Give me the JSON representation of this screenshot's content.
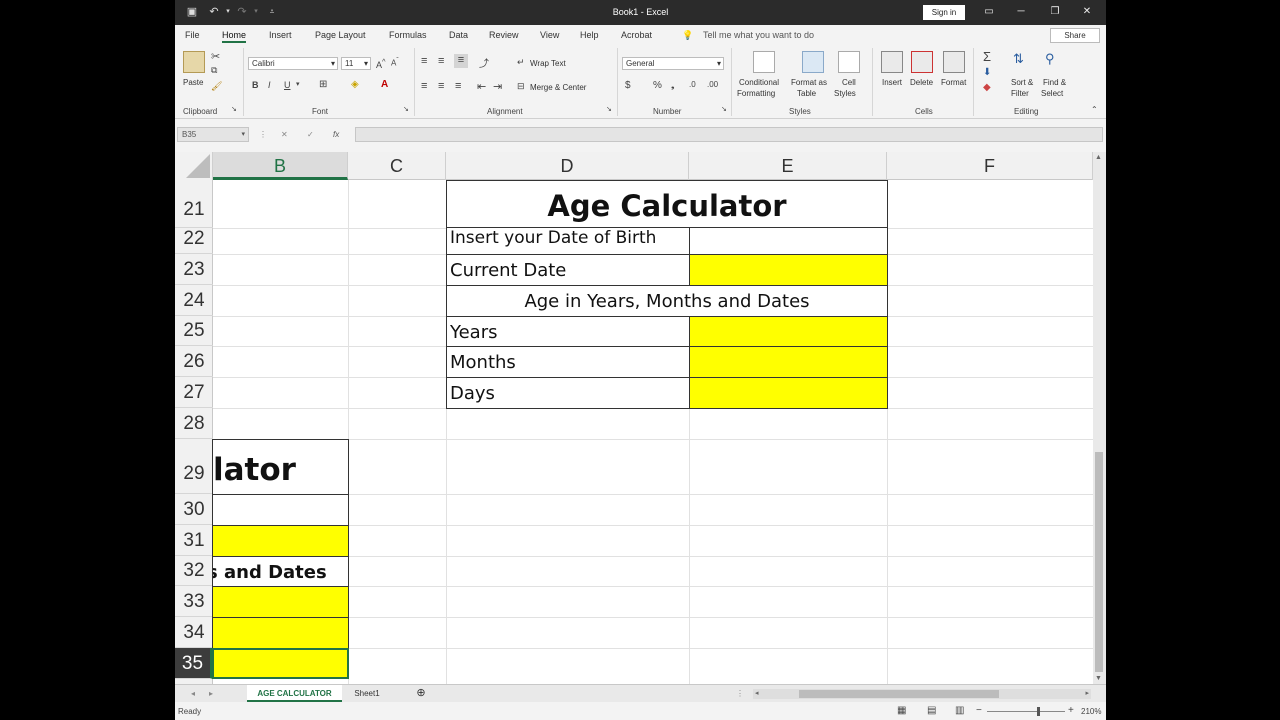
{
  "window": {
    "title": "Book1 - Excel",
    "signin_label": "Sign in"
  },
  "ribbon_tabs": [
    "File",
    "Home",
    "Insert",
    "Page Layout",
    "Formulas",
    "Data",
    "Review",
    "View",
    "Help",
    "Acrobat"
  ],
  "tell_me": "Tell me what you want to do",
  "share_label": "Share",
  "ribbon": {
    "clipboard": {
      "paste": "Paste",
      "label": "Clipboard"
    },
    "font": {
      "name": "Calibri",
      "size": "11",
      "label": "Font"
    },
    "alignment": {
      "wrap_text": "Wrap Text",
      "merge_center": "Merge & Center",
      "label": "Alignment"
    },
    "number": {
      "format": "General",
      "label": "Number"
    },
    "styles": {
      "conditional": "Conditional",
      "formatting": "Formatting",
      "format_as": "Format as",
      "table": "Table",
      "cell": "Cell",
      "cell_styles": "Styles",
      "label": "Styles"
    },
    "cells": {
      "insert": "Insert",
      "delete": "Delete",
      "format": "Format",
      "label": "Cells"
    },
    "editing": {
      "sort": "Sort &",
      "filter": "Filter",
      "find": "Find &",
      "select": "Select",
      "label": "Editing"
    }
  },
  "formula_bar": {
    "name_box": "B35",
    "fx": "fx",
    "value": ""
  },
  "columns": [
    "B",
    "C",
    "D",
    "E",
    "F"
  ],
  "rows": [
    "21",
    "22",
    "23",
    "24",
    "25",
    "26",
    "27",
    "28",
    "29",
    "30",
    "31",
    "32",
    "33",
    "34",
    "35"
  ],
  "table": {
    "title": "Age Calculator",
    "dob_label": "Insert your Date of Birth",
    "current_label": "Current Date",
    "age_header": "Age in Years, Months and Dates",
    "years_label": "Years",
    "months_label": "Months",
    "days_label": "Days"
  },
  "left_fragment": {
    "title_tail": "lator",
    "header_tail": "s and Dates"
  },
  "sheets": [
    "AGE CALCULATOR",
    "Sheet1"
  ],
  "status": {
    "ready": "Ready",
    "zoom": "210%"
  },
  "colors": {
    "excel_green": "#217346",
    "highlight": "#ffff00"
  }
}
